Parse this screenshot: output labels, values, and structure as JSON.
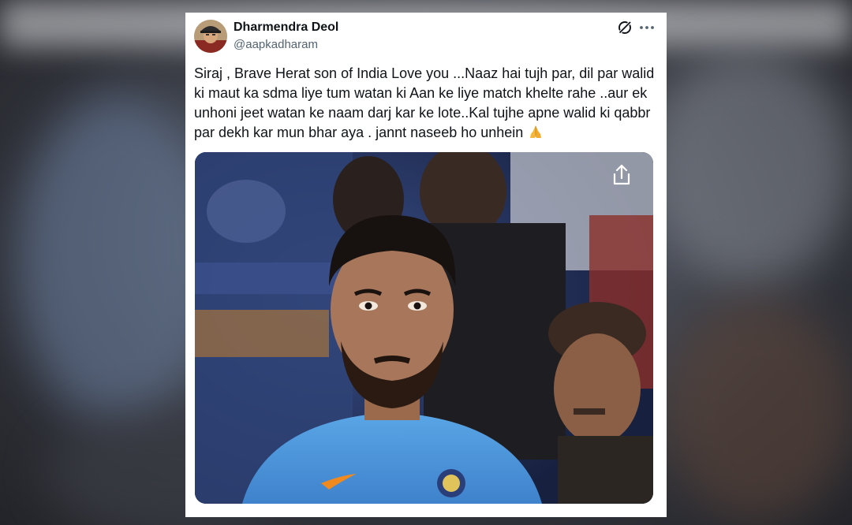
{
  "post": {
    "author": {
      "display_name": "Dharmendra Deol",
      "handle": "@aapkadharam",
      "avatar_icon": "profile-avatar"
    },
    "text": "Siraj , Brave Herat son of India Love you ...Naaz hai tujh par, dil par walid ki maut ka sdma liye tum watan ki Aan ke liye match khelte rahe ..aur  ek unhoni jeet watan ke naam darj kar ke lote..Kal tujhe apne walid ki qabbr par dekh kar mun bhar aya . jannt naseeb ho unhein",
    "emoji": "folded-hands",
    "actions": {
      "grok_icon": "grok-icon",
      "more_icon": "more-options-icon",
      "share_icon": "share-icon"
    },
    "media": {
      "type": "photo",
      "description_icon": "cricketer-photo"
    }
  },
  "colors": {
    "text": "#0f1419",
    "secondary_text": "#536471",
    "card_bg": "#ffffff",
    "jersey_blue": "#4a8fd6"
  }
}
